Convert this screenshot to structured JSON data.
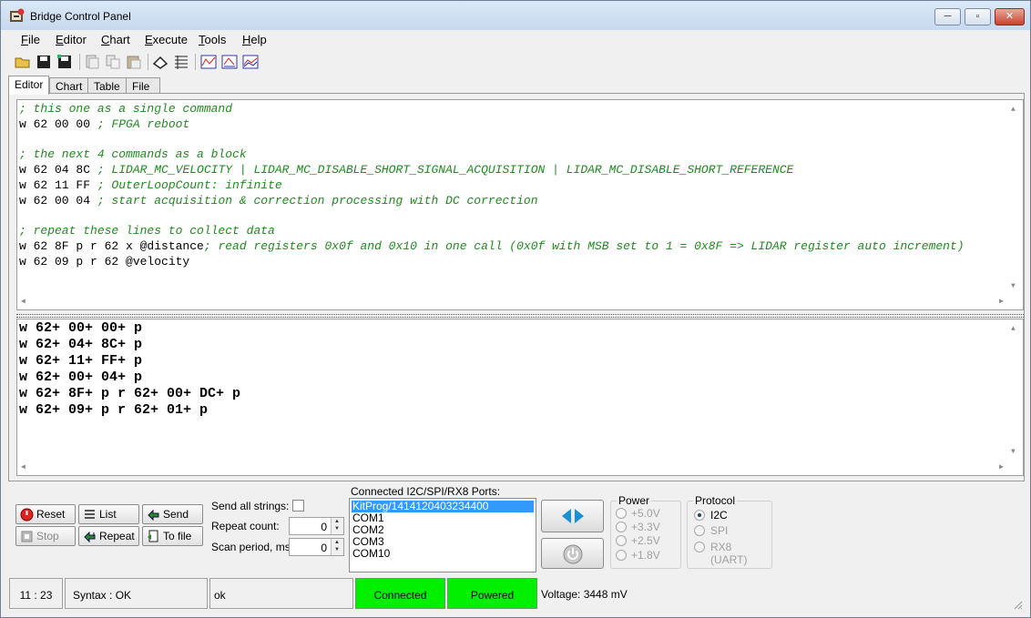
{
  "window": {
    "title": "Bridge Control Panel",
    "controls": {
      "minimize": "─",
      "maximize": "▫",
      "close": "✕"
    }
  },
  "menu": {
    "items": [
      {
        "label": "File",
        "u": "F",
        "rest": "ile"
      },
      {
        "label": "Editor",
        "u": "E",
        "rest": "ditor"
      },
      {
        "label": "Chart",
        "u": "C",
        "rest": "hart"
      },
      {
        "label": "Execute",
        "u": "E",
        "rest": "xecute"
      },
      {
        "label": "Tools",
        "u": "T",
        "rest": "ools"
      },
      {
        "label": "Help",
        "u": "H",
        "rest": "elp"
      }
    ]
  },
  "toolbar": {
    "icons": [
      "open-folder-icon",
      "save-icon",
      "save-as-icon",
      "copy-doc-icon",
      "copy-icon",
      "paste-icon",
      "clear-icon",
      "list-icon",
      "chart-line-icon",
      "chart-scatter-icon",
      "chart-multi-icon"
    ]
  },
  "tabs": {
    "editor": "Editor",
    "chart": "Chart",
    "table": "Table",
    "file": "File"
  },
  "script": {
    "lines": [
      {
        "cmd": "",
        "comment": "; this one as a single command"
      },
      {
        "cmd": "w 62 00 00 ",
        "comment": "; FPGA reboot"
      },
      {
        "cmd": "",
        "comment": ""
      },
      {
        "cmd": "",
        "comment": "; the next 4 commands as a block"
      },
      {
        "cmd": "w 62 04 8C ",
        "comment": "; LIDAR_MC_VELOCITY | LIDAR_MC_DISABLE_SHORT_SIGNAL_ACQUISITION | LIDAR_MC_DISABLE_SHORT_REFERENCE"
      },
      {
        "cmd": "w 62 11 FF ",
        "comment": "; OuterLoopCount: infinite"
      },
      {
        "cmd": "w 62 00 04 ",
        "comment": "; start acquisition & correction processing with DC correction"
      },
      {
        "cmd": "",
        "comment": ""
      },
      {
        "cmd": "",
        "comment": "; repeat these lines to collect data"
      },
      {
        "cmd": "w 62 8F p r 62 x @distance",
        "comment": "; read registers 0x0f and 0x10 in one call (0x0f with MSB set to 1 = 0x8F => LIDAR register auto increment)"
      },
      {
        "cmd": "w 62 09 p r 62 @velocity",
        "comment": ""
      }
    ]
  },
  "output": {
    "lines": [
      "w 62+ 00+ 00+ p",
      "w 62+ 04+ 8C+ p",
      "w 62+ 11+ FF+ p",
      "w 62+ 00+ 04+ p",
      "w 62+ 8F+ p r 62+ 00+ DC+ p",
      "w 62+ 09+ p r 62+ 01+ p"
    ]
  },
  "controls": {
    "reset": "Reset",
    "list": "List",
    "send": "Send",
    "stop": "Stop",
    "repeat": "Repeat",
    "to_file": "To file",
    "send_all_strings_label": "Send all strings:",
    "repeat_count_label": "Repeat count:",
    "repeat_count_value": "0",
    "scan_period_label": "Scan period, ms:",
    "scan_period_value": "0"
  },
  "ports": {
    "label": "Connected I2C/SPI/RX8 Ports:",
    "items": [
      "KitProg/1414120403234400",
      "COM1",
      "COM2",
      "COM3",
      "COM10"
    ],
    "selected_index": 0
  },
  "power": {
    "title": "Power",
    "options": [
      "+5.0V",
      "+3.3V",
      "+2.5V",
      "+1.8V"
    ]
  },
  "protocol": {
    "title": "Protocol",
    "options": [
      "I2C",
      "SPI",
      "RX8 (UART)"
    ],
    "selected": "I2C"
  },
  "status": {
    "position": "11 : 23",
    "syntax": "Syntax : OK",
    "message": "ok",
    "connected": "Connected",
    "powered": "Powered",
    "voltage": "Voltage: 3448 mV",
    "status_color": "#00f000"
  }
}
